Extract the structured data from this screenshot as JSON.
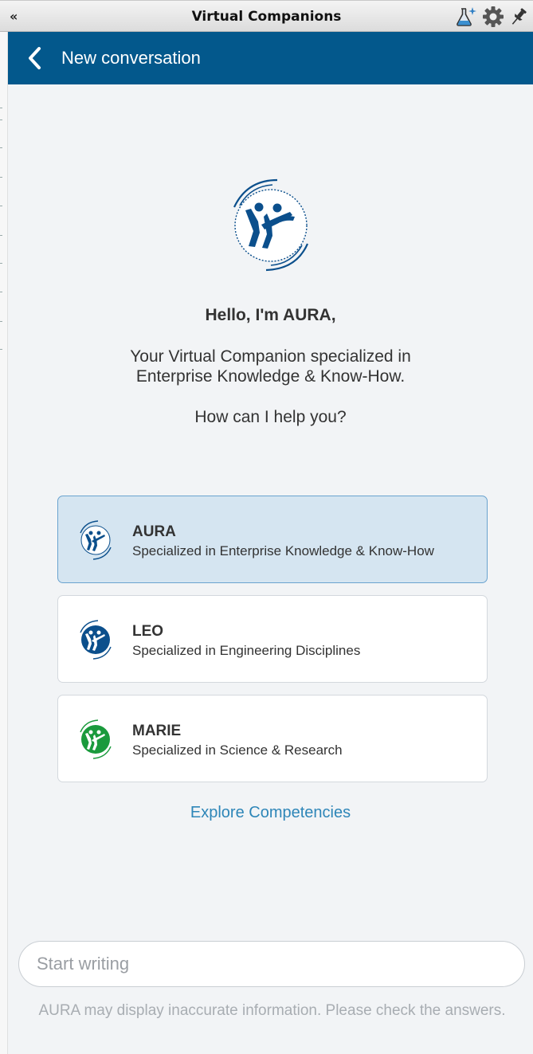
{
  "window": {
    "title": "Virtual Companions",
    "collapse_glyph": "«",
    "icons": [
      "collapse-icon",
      "flask-sparkle-icon",
      "gear-icon",
      "pin-icon"
    ]
  },
  "header": {
    "back_icon": "chevron-left-icon",
    "title": "New conversation",
    "bg_color": "#03588c"
  },
  "greeting": {
    "title": "Hello, I'm AURA,",
    "line1": "Your Virtual Companion specialized in",
    "line2": "Enterprise Knowledge & Know-How.",
    "question": "How can I help you?"
  },
  "companions": [
    {
      "name": "AURA",
      "description": "Specialized in Enterprise Knowledge & Know-How",
      "selected": true,
      "color": "#ffffff"
    },
    {
      "name": "LEO",
      "description": "Specialized in Engineering Disciplines",
      "selected": false,
      "color": "#0b4f8c"
    },
    {
      "name": "MARIE",
      "description": "Specialized in Science & Research",
      "selected": false,
      "color": "#1a9a3c"
    }
  ],
  "explore_link": "Explore Competencies",
  "composer": {
    "placeholder": "Start writing",
    "value": ""
  },
  "disclaimer": "AURA may display inaccurate information. Please check the answers.",
  "colors": {
    "accent": "#03588c",
    "link": "#2e86b8",
    "selected_card": "#d5e5f1"
  }
}
